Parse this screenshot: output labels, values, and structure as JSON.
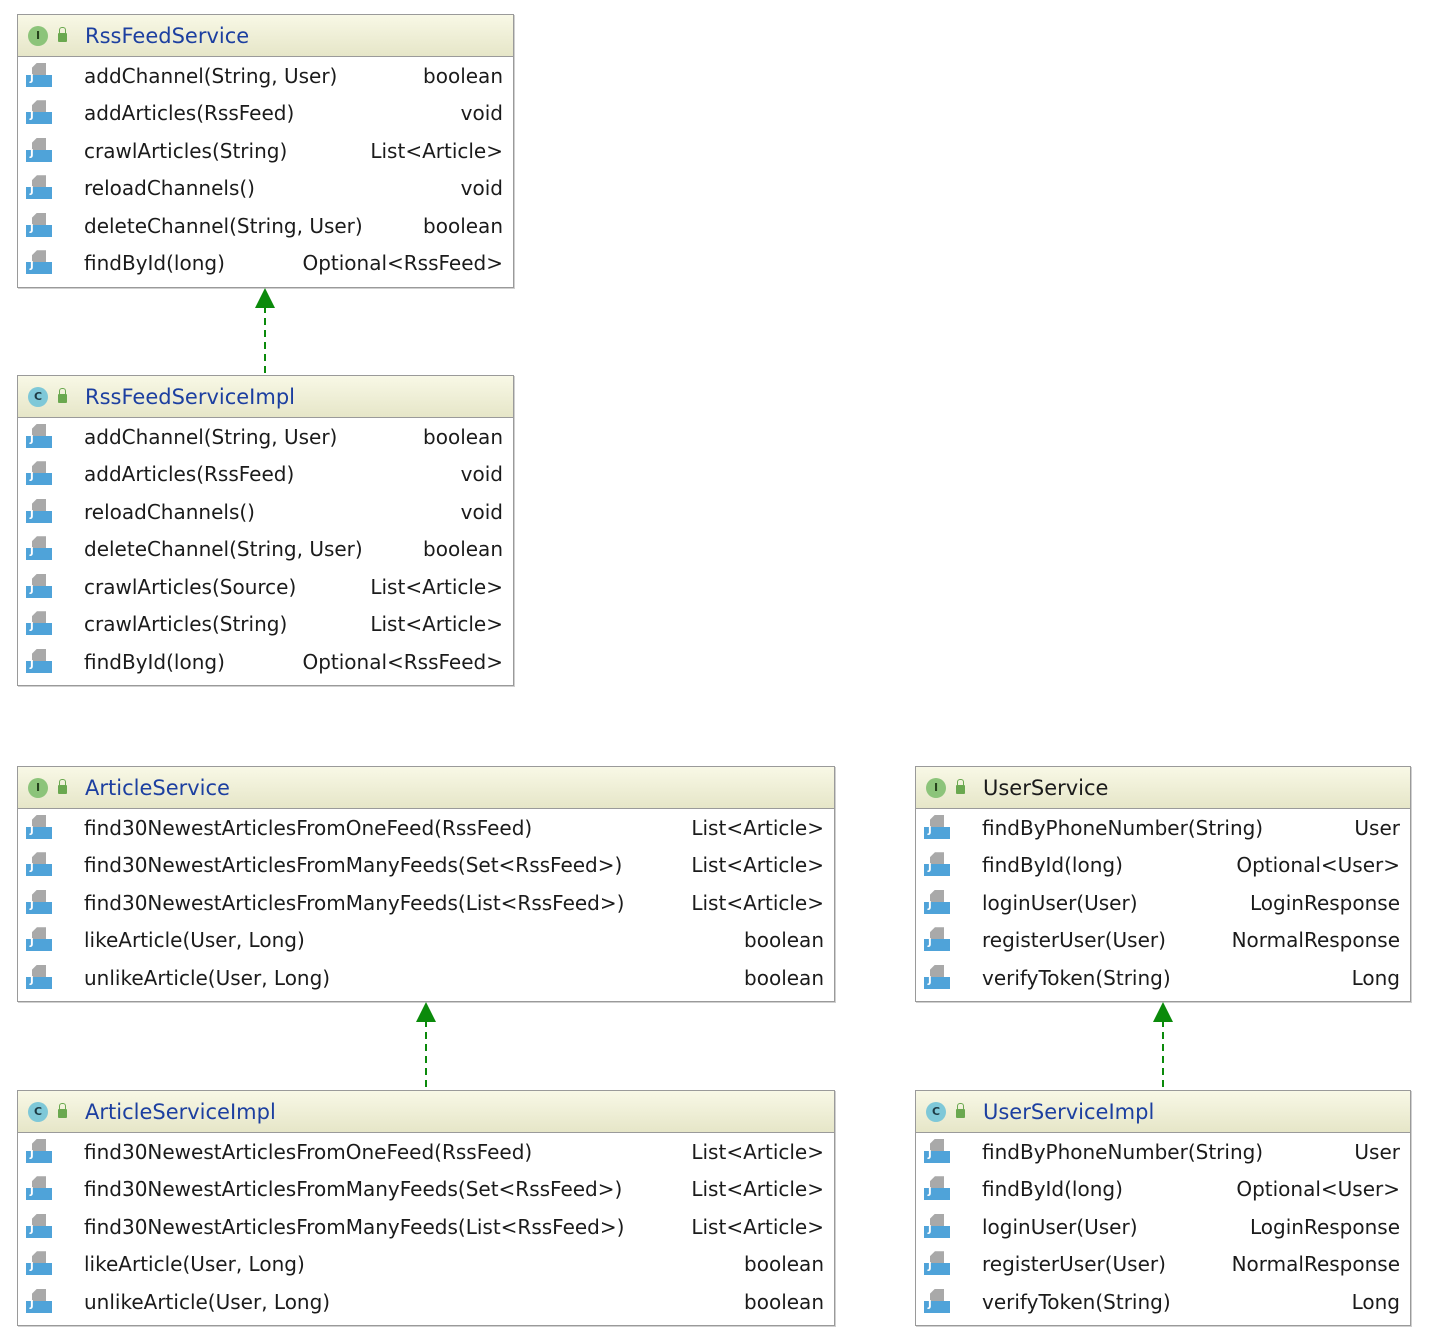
{
  "classes": {
    "rss_service": {
      "name": "RssFeedService",
      "kind": "I",
      "methods": [
        {
          "name": "addChannel(String, User)",
          "type": "boolean"
        },
        {
          "name": "addArticles(RssFeed)",
          "type": "void"
        },
        {
          "name": "crawlArticles(String)",
          "type": "List<Article>"
        },
        {
          "name": "reloadChannels()",
          "type": "void"
        },
        {
          "name": "deleteChannel(String, User)",
          "type": "boolean"
        },
        {
          "name": "findById(long)",
          "type": "Optional<RssFeed>"
        }
      ]
    },
    "rss_impl": {
      "name": "RssFeedServiceImpl",
      "kind": "C",
      "methods": [
        {
          "name": "addChannel(String, User)",
          "type": "boolean"
        },
        {
          "name": "addArticles(RssFeed)",
          "type": "void"
        },
        {
          "name": "reloadChannels()",
          "type": "void"
        },
        {
          "name": "deleteChannel(String, User)",
          "type": "boolean"
        },
        {
          "name": "crawlArticles(Source)",
          "type": "List<Article>"
        },
        {
          "name": "crawlArticles(String)",
          "type": "List<Article>"
        },
        {
          "name": "findById(long)",
          "type": "Optional<RssFeed>"
        }
      ]
    },
    "article_service": {
      "name": "ArticleService",
      "kind": "I",
      "methods": [
        {
          "name": "find30NewestArticlesFromOneFeed(RssFeed)",
          "type": "List<Article>"
        },
        {
          "name": "find30NewestArticlesFromManyFeeds(Set<RssFeed>)",
          "type": "List<Article>"
        },
        {
          "name": "find30NewestArticlesFromManyFeeds(List<RssFeed>)",
          "type": "List<Article>"
        },
        {
          "name": "likeArticle(User, Long)",
          "type": "boolean"
        },
        {
          "name": "unlikeArticle(User, Long)",
          "type": "boolean"
        }
      ]
    },
    "article_impl": {
      "name": "ArticleServiceImpl",
      "kind": "C",
      "methods": [
        {
          "name": "find30NewestArticlesFromOneFeed(RssFeed)",
          "type": "List<Article>"
        },
        {
          "name": "find30NewestArticlesFromManyFeeds(Set<RssFeed>)",
          "type": "List<Article>"
        },
        {
          "name": "find30NewestArticlesFromManyFeeds(List<RssFeed>)",
          "type": "List<Article>"
        },
        {
          "name": "likeArticle(User, Long)",
          "type": "boolean"
        },
        {
          "name": "unlikeArticle(User, Long)",
          "type": "boolean"
        }
      ]
    },
    "user_service": {
      "name": "UserService",
      "kind": "I",
      "methods": [
        {
          "name": "findByPhoneNumber(String)",
          "type": "User"
        },
        {
          "name": "findById(long)",
          "type": "Optional<User>"
        },
        {
          "name": "loginUser(User)",
          "type": "LoginResponse"
        },
        {
          "name": "registerUser(User)",
          "type": "NormalResponse"
        },
        {
          "name": "verifyToken(String)",
          "type": "Long"
        }
      ]
    },
    "user_impl": {
      "name": "UserServiceImpl",
      "kind": "C",
      "methods": [
        {
          "name": "findByPhoneNumber(String)",
          "type": "User"
        },
        {
          "name": "findById(long)",
          "type": "Optional<User>"
        },
        {
          "name": "loginUser(User)",
          "type": "LoginResponse"
        },
        {
          "name": "registerUser(User)",
          "type": "NormalResponse"
        },
        {
          "name": "verifyToken(String)",
          "type": "Long"
        }
      ]
    }
  },
  "colors": {
    "arrow": "#0b8a0b",
    "title_blue": "#1c3fa0"
  }
}
